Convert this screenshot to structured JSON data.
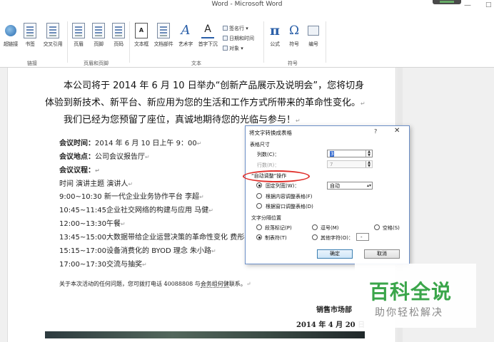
{
  "window": {
    "title": "Word - Microsoft Word",
    "minimize": "—",
    "maximize": "□"
  },
  "ribbon": {
    "links": [
      "超链接",
      "书签",
      "交叉引用"
    ],
    "links_group": "链接",
    "header_footer": [
      "页眉",
      "页脚",
      "页码"
    ],
    "header_footer_group": "页眉和页脚",
    "text_items": [
      "文本框",
      "文档部件",
      "艺术字",
      "首字下沉"
    ],
    "text_small": [
      "签名行",
      "日期和时间",
      "对象"
    ],
    "text_group": "文本",
    "symbol_items": [
      "公式",
      "符号",
      "编号"
    ],
    "symbol_group": "符号"
  },
  "document": {
    "line1": "本公司将于 2014 年 6 月 10 日举办“创新产品展示及说明会”，您将切身",
    "line2": "体验到新技术、新平台、新应用为您的生活和工作方式所带来的革命性变化。",
    "line3": "我们已经为您预留了座位，真诚地期待您的光临与参与！",
    "time_label": "会议时间：",
    "time_value": "2014 年 6 月 10 日上午 9：00",
    "place_label": "会议地点：",
    "place_value": "公司会议报告厅",
    "agenda_label": "会议议程：",
    "agenda_header": "时间      演讲主题      演讲人",
    "agenda": [
      "9:00~10:30 新一代企业业务协作平台  李超",
      "10:45~11:45企业社交网络的构建与应用      马健",
      "12:00~13:30午餐",
      "13:45~15:00大数据带给企业运营决策的革命性变化  费彤",
      "15:15~17:00设备消费化的 BYOD 理念  朱小路",
      "17:00~17:30交流与抽奖"
    ],
    "contact_pre": "关于本次活动的任何问题，您可拨打电话 40088808 与",
    "contact_name": "会务组何健",
    "contact_post": "联系。",
    "sign_dept": "销售市场部",
    "sign_date": "2014 年 4 月 20 日"
  },
  "dialog": {
    "title": "将文字转换成表格",
    "help": "?",
    "close": "✕",
    "size_section": "表格尺寸",
    "cols_label": "列数(C)：",
    "cols_value": "3",
    "rows_label": "行数(R)：",
    "rows_value": "7",
    "autofit_section": "“自动调整”操作",
    "fixed_label": "固定列宽(W)：",
    "fixed_value": "自动",
    "fit_content": "根据内容调整表格(F)",
    "fit_window": "根据窗口调整表格(D)",
    "sep_section": "文字分隔位置",
    "sep_para": "段落标记(P)",
    "sep_comma": "逗号(M)",
    "sep_space": "空格(S)",
    "sep_tab": "制表符(T)",
    "sep_other": "其他字符(O)：",
    "sep_other_value": "-",
    "ok": "确定",
    "cancel": "取消"
  },
  "watermark": {
    "main": "百科全说",
    "sub": "助你轻松解决"
  },
  "colors": {
    "annotation": "#e0302c",
    "watermark": "#3aa54a"
  }
}
